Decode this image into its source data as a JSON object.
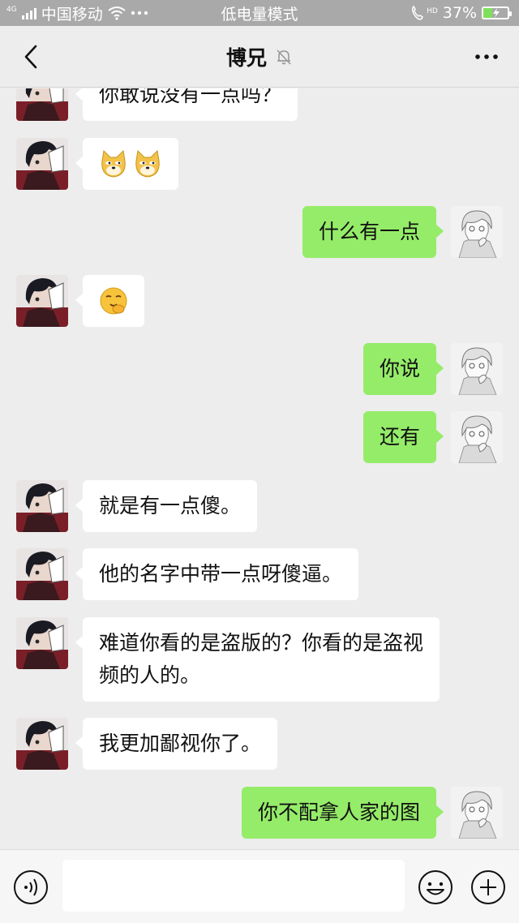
{
  "status_bar": {
    "network_type": "4G",
    "carrier": "中国移动",
    "mode": "低电量模式",
    "hd_label": "HD",
    "battery_text": "37%",
    "battery_level": 0.37
  },
  "header": {
    "title": "博兄"
  },
  "messages": [
    {
      "side": "left",
      "text": "你敢说没有一点吗？"
    },
    {
      "side": "left",
      "emoji": "doge-emoji-x2"
    },
    {
      "side": "right",
      "text": "什么有一点"
    },
    {
      "side": "left",
      "emoji": "smirk-emoji"
    },
    {
      "side": "right",
      "text": "你说"
    },
    {
      "side": "right",
      "text": "还有"
    },
    {
      "side": "left",
      "text": "就是有一点傻。"
    },
    {
      "side": "left",
      "text": "他的名字中带一点呀傻逼。"
    },
    {
      "side": "left",
      "text": "难道你看的是盗版的？你看的是盗视频的人的。"
    },
    {
      "side": "left",
      "text": "我更加鄙视你了。"
    },
    {
      "side": "right",
      "text": "你不配拿人家的图"
    }
  ],
  "input_bar": {
    "value": ""
  },
  "colors": {
    "background": "#ededed",
    "self_bubble": "#95ec69",
    "other_bubble": "#ffffff",
    "status_bar": "#a9a9a9"
  }
}
